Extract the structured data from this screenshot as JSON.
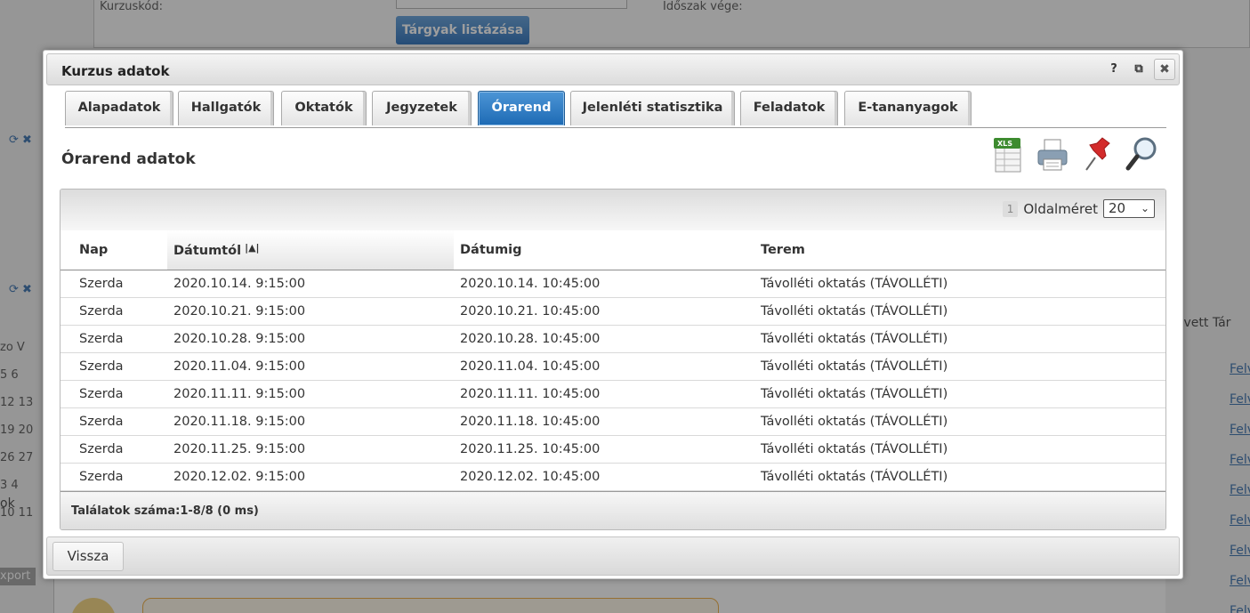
{
  "background": {
    "course_code_label": "Kurzuskód:",
    "period_end_label": "Időszak vége:",
    "list_subjects_button": "Tárgyak listázása",
    "ok_text": "ok",
    "export_text": "xport",
    "right_col_header": "elvett  Tár",
    "right_links": [
      "Felv",
      "Felv",
      "Felv",
      "Felv",
      "Felv",
      "Felv",
      "Felv",
      "Felv",
      "Felv"
    ],
    "calendar_rows": [
      "zo  V",
      "5    6",
      "12  13",
      "19  20",
      "26  27",
      "3    4",
      "10  11"
    ]
  },
  "dialog": {
    "title": "Kurzus adatok",
    "help_label": "?",
    "popout_label": "⧉",
    "close_label": "✖",
    "tabs": [
      {
        "label": "Alapadatok"
      },
      {
        "label": "Hallgatók"
      },
      {
        "label": "Oktatók"
      },
      {
        "label": "Jegyzetek"
      },
      {
        "label": "Órarend",
        "active": true
      },
      {
        "label": "Jelenléti statisztika"
      },
      {
        "label": "Feladatok"
      },
      {
        "label": "E-tananyagok"
      }
    ],
    "section_title": "Órarend adatok",
    "actions": [
      "xls-export-icon",
      "print-icon",
      "pin-icon",
      "search-icon"
    ],
    "xls_label": "XLS",
    "pager": {
      "current_page": "1",
      "page_size_label": "Oldalméret",
      "page_size_value": "20"
    },
    "columns": [
      "Nap",
      "Dátumtól",
      "Dátumig",
      "Terem"
    ],
    "sort_indicator": "|▲|",
    "rows": [
      [
        "Szerda",
        "2020.10.14. 9:15:00",
        "2020.10.14. 10:45:00",
        "Távolléti oktatás (TÁVOLLÉTI)"
      ],
      [
        "Szerda",
        "2020.10.21. 9:15:00",
        "2020.10.21. 10:45:00",
        "Távolléti oktatás (TÁVOLLÉTI)"
      ],
      [
        "Szerda",
        "2020.10.28. 9:15:00",
        "2020.10.28. 10:45:00",
        "Távolléti oktatás (TÁVOLLÉTI)"
      ],
      [
        "Szerda",
        "2020.11.04. 9:15:00",
        "2020.11.04. 10:45:00",
        "Távolléti oktatás (TÁVOLLÉTI)"
      ],
      [
        "Szerda",
        "2020.11.11. 9:15:00",
        "2020.11.11. 10:45:00",
        "Távolléti oktatás (TÁVOLLÉTI)"
      ],
      [
        "Szerda",
        "2020.11.18. 9:15:00",
        "2020.11.18. 10:45:00",
        "Távolléti oktatás (TÁVOLLÉTI)"
      ],
      [
        "Szerda",
        "2020.11.25. 9:15:00",
        "2020.11.25. 10:45:00",
        "Távolléti oktatás (TÁVOLLÉTI)"
      ],
      [
        "Szerda",
        "2020.12.02. 9:15:00",
        "2020.12.02. 10:45:00",
        "Távolléti oktatás (TÁVOLLÉTI)"
      ]
    ],
    "results_text": "Találatok száma:1-8/8 (0 ms)",
    "back_button": "Vissza"
  },
  "colors": {
    "accent": "#1d6ab4",
    "overlay": "#9a9a9a"
  }
}
